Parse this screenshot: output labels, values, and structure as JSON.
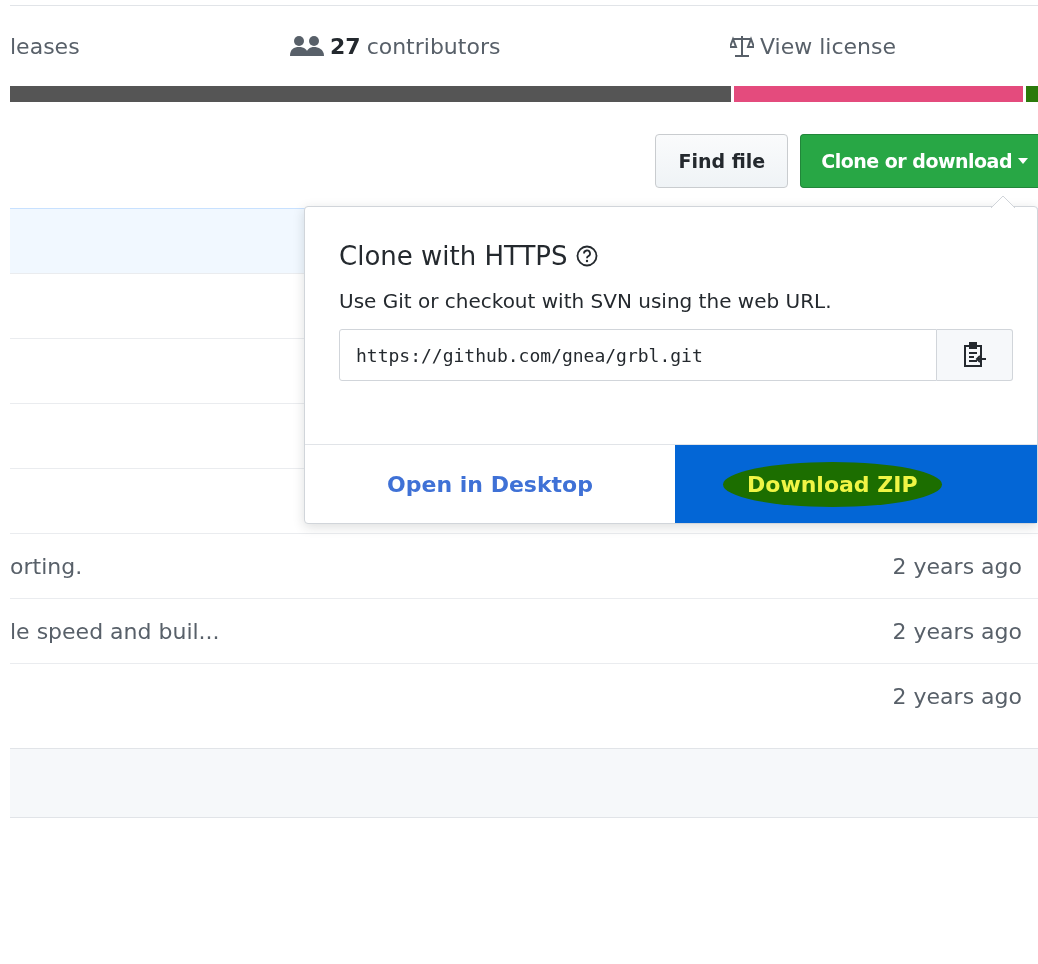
{
  "summary": {
    "stats": [
      {
        "kind": "releases",
        "label": "leases"
      },
      {
        "kind": "contributors",
        "count": "27",
        "label": "contributors"
      },
      {
        "kind": "license",
        "label": "View license"
      }
    ]
  },
  "language_bar": [
    {
      "color": "#555555"
    },
    {
      "color": "#e44b7d"
    },
    {
      "color": "#2b7a0b"
    }
  ],
  "toolbar": {
    "find_file": "Find file",
    "clone_button": "Clone or download"
  },
  "files": [
    {
      "kind": "commit"
    },
    {
      "kind": "file"
    },
    {
      "kind": "file"
    },
    {
      "kind": "file"
    },
    {
      "kind": "file"
    },
    {
      "kind": "file",
      "message": "orting.",
      "age": "2 years ago"
    },
    {
      "kind": "file",
      "message": "le speed and buil...",
      "age": "2 years ago"
    },
    {
      "kind": "file",
      "age": "2 years ago"
    }
  ],
  "clone_popover": {
    "title": "Clone with HTTPS",
    "description": "Use Git or checkout with SVN using the web URL.",
    "url": "https://github.com/gnea/grbl.git",
    "open_desktop": "Open in Desktop",
    "download_zip": "Download ZIP"
  }
}
